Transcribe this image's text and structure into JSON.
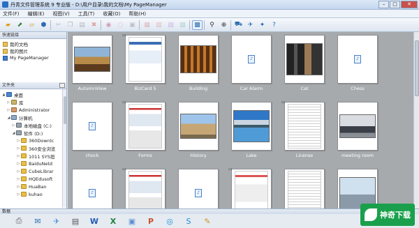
{
  "window": {
    "title": "丹青文件管理系统 9 专业版 - D:\\用户目录\\我的文档\\My PageManager",
    "min": "–",
    "max": "□",
    "close": "✕"
  },
  "menu": [
    "文件(F)",
    "编辑(E)",
    "视图(V)",
    "工具(T)",
    "收藏(O)",
    "帮助(H)"
  ],
  "sidebar": {
    "quick_header": "快速链接",
    "quick_links": [
      {
        "label": "我的文档",
        "icon": "folder-icon"
      },
      {
        "label": "我的图片",
        "icon": "folder-icon"
      },
      {
        "label": "My PageManager",
        "icon": "pagemanager-icon"
      }
    ],
    "tree_header": "文件夹",
    "tree": [
      {
        "label": "桌面",
        "icon": "desktop",
        "level": 0,
        "twist": "▲"
      },
      {
        "label": "库",
        "icon": "lib",
        "level": 1,
        "twist": "▷"
      },
      {
        "label": "Administrator",
        "icon": "usr",
        "level": 1,
        "twist": "▷"
      },
      {
        "label": "计算机",
        "icon": "pc",
        "level": 1,
        "twist": "◢"
      },
      {
        "label": "本地磁盘 (C:)",
        "icon": "drv",
        "level": 2,
        "twist": "▷"
      },
      {
        "label": "软件 (D:)",
        "icon": "drv",
        "level": 2,
        "twist": "◢"
      },
      {
        "label": "360Downlc",
        "icon": "folder",
        "level": 3,
        "twist": "▷"
      },
      {
        "label": "360安全浏览",
        "icon": "folder",
        "level": 3,
        "twist": "▷"
      },
      {
        "label": "1011 SYS扭",
        "icon": "folder",
        "level": 3,
        "twist": "▷"
      },
      {
        "label": "BaiduNetd",
        "icon": "folder",
        "level": 3,
        "twist": "▷"
      },
      {
        "label": "CubeLibrar",
        "icon": "folder",
        "level": 3,
        "twist": "▷"
      },
      {
        "label": "HQEdusoft",
        "icon": "folder",
        "level": 3,
        "twist": "▷"
      },
      {
        "label": "HuaBan",
        "icon": "folder",
        "level": 3,
        "twist": "▷"
      },
      {
        "label": "kuhao",
        "icon": "folder",
        "level": 3,
        "twist": "▷"
      }
    ]
  },
  "items": [
    {
      "caption": "AutumnView",
      "kind": "pic",
      "style": "autumn"
    },
    {
      "caption": "BizCard 5",
      "kind": "doc",
      "style": "bizcard",
      "mark": "▭"
    },
    {
      "caption": "Building",
      "kind": "pic",
      "style": "building"
    },
    {
      "caption": "Car Alarm",
      "kind": "file"
    },
    {
      "caption": "Cat",
      "kind": "pic",
      "style": "cat"
    },
    {
      "caption": "Chess",
      "kind": "file"
    },
    {
      "caption": "chock",
      "kind": "file"
    },
    {
      "caption": "Forms",
      "kind": "doc",
      "style": "forms",
      "mark": "▭"
    },
    {
      "caption": "History",
      "kind": "pic",
      "style": "colosseum"
    },
    {
      "caption": "Lake",
      "kind": "pic",
      "style": "lake"
    },
    {
      "caption": "License",
      "kind": "doc",
      "style": "text",
      "mark": "▭"
    },
    {
      "caption": "meeting room",
      "kind": "pic",
      "style": "meeting"
    },
    {
      "caption": "",
      "kind": "file"
    },
    {
      "caption": "",
      "kind": "doc",
      "style": "forms",
      "mark": "▭"
    },
    {
      "caption": "",
      "kind": "file"
    },
    {
      "caption": "",
      "kind": "doc",
      "style": "forms2",
      "mark": "▭"
    },
    {
      "caption": "",
      "kind": "doc",
      "style": "text"
    },
    {
      "caption": "",
      "kind": "pic",
      "style": "pagoda"
    }
  ],
  "bottom": {
    "header": "数据"
  },
  "watermark": {
    "text": "神奇下载"
  }
}
